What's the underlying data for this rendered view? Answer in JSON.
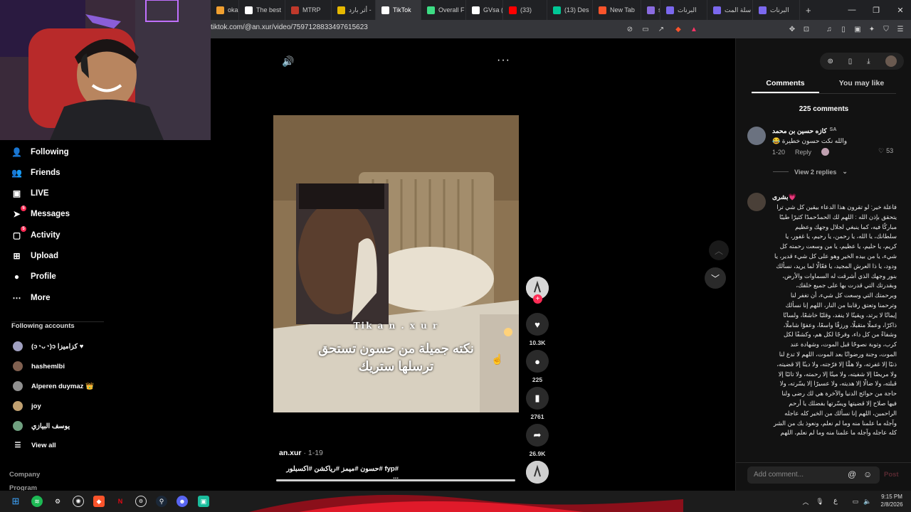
{
  "browser": {
    "tabs": [
      {
        "label": "okanTF",
        "color": "#f0a030"
      },
      {
        "label": "The best",
        "color": "#ffffff"
      },
      {
        "label": "MTRP",
        "color": "#c0392b"
      },
      {
        "label": "أثر بارد -",
        "color": "#e6b800"
      },
      {
        "label": "TikTok",
        "color": "#ffffff",
        "active": true
      },
      {
        "label": "Overall F",
        "color": "#3ddc84"
      },
      {
        "label": "GVsa (@",
        "color": "#ffffff"
      },
      {
        "label": "(33)",
        "color": "#ff0000"
      },
      {
        "label": "(13) Des",
        "color": "#00c896"
      },
      {
        "label": "New Tab",
        "color": "#fb542b"
      },
      {
        "label": "spe",
        "color": "#8a6be0"
      },
      {
        "label": "البرنات",
        "color": "#7b68ee"
      },
      {
        "label": "سلة المت",
        "color": "#7b68ee"
      },
      {
        "label": "البرنات",
        "color": "#7b68ee"
      }
    ],
    "new_tab": "+",
    "url": "tiktok.com/@an.xur/video/7597128833497615623"
  },
  "sidebar": {
    "nav": [
      {
        "label": "Following",
        "icon": "following-icon",
        "glyph": "👤"
      },
      {
        "label": "Friends",
        "icon": "friends-icon",
        "glyph": "👥"
      },
      {
        "label": "LIVE",
        "icon": "live-icon",
        "glyph": "▣"
      },
      {
        "label": "Messages",
        "icon": "messages-icon",
        "glyph": "➤",
        "badge": "5"
      },
      {
        "label": "Activity",
        "icon": "activity-icon",
        "glyph": "▢",
        "badge": "5"
      },
      {
        "label": "Upload",
        "icon": "upload-icon",
        "glyph": "⊞"
      },
      {
        "label": "Profile",
        "icon": "profile-icon",
        "glyph": "●"
      },
      {
        "label": "More",
        "icon": "more-icon",
        "glyph": "⋯"
      }
    ],
    "following_title": "Following accounts",
    "accounts": [
      {
        "name": "(ↄ◔ᴗ◔)ↄ كزاميزا ♥",
        "color": "#a0a0c0"
      },
      {
        "name": "hashemlbi",
        "color": "#806050"
      },
      {
        "name": "Alperen duymaz 👑",
        "color": "#909090"
      },
      {
        "name": "joy",
        "color": "#c0a070"
      },
      {
        "name": "يوسف البيازي",
        "color": "#70a080"
      }
    ],
    "view_all": "View all",
    "footer": [
      "Company",
      "Program"
    ]
  },
  "video": {
    "watermark": "Tik a n . x u r",
    "caption_line1": "نكته جميلة من حسون تستحق",
    "caption_line2": "ترسلها ستريك",
    "author": "an.xur",
    "date": "· 1-19",
    "hashtags": "#fyp #حسون #ميمز #رياكشن #اكسبلور ..."
  },
  "actions": {
    "likes": "10.3K",
    "comments": "225",
    "saves": "2761",
    "shares": "26.9K"
  },
  "panel": {
    "tab_comments": "Comments",
    "tab_like": "You may like",
    "count": "225 comments",
    "comments": [
      {
        "author": "كازه حسين بن محمد",
        "flag": "SA",
        "text": "والله نكت حسون خطيرة 😂",
        "date": "1-20",
        "reply": "Reply",
        "likes": "53",
        "view_replies": "View 2 replies"
      },
      {
        "author": "بشرى💗",
        "text": "فاعلة خير: لو تقرون هذا الدعاء بيقين كل شي ترا يتحقق بإذن الله : اللهم لك الحمدُحمدًا كثيرًا طيبًا مباركًا فيه، كما ينبغي لجلال وجهك وعظيم سلطانك، يا الله، يا رحمن، يا رحيم، يا غفور، يا كريم، يا حليم، يا عظيم، يا من وسعت رحمته كل شيء، يا من بيده الخير وهو على كل شيء قدير، يا ودود، يا ذا العرش المجيد، يا فعّالًا لما يريد، نسألك بنور وجهك الذي أشرقت له السماوات والأرض، وبقدرتك التي قدرت بها على جميع خلقك، وبرحمتك التي وسعت كل شيء، أن تغفر لنا وترحمنا وتعتق رقابنا من النار، اللهم إنا نسألك إيمانًا لا يرتد، ويقينًا لا ينفد، وقلبًا خاشعًا، ولسانًا ذاكرًا، وعملًا متقبلًا، ورزقًا واسعًا، وعفوًا شاملًا، وشفاءً من كل داء، وفرجًا لكل هم، وكشفًا لكل كرب، وتوبة نصوحًا قبل الموت، وشهادة عند الموت، وجنة ورضوانًا بعد الموت، اللهم لا تدع لنا ذنبًا إلا غفرته، ولا همًّا إلا فرّجته، ولا دينًا إلا قضيته، ولا مريضًا إلا شفيته، ولا ميتًا إلا رحمته، ولا تائبًا إلا قبلته، ولا ضالًا إلا هديته، ولا عسيرًا إلا يسّرته، ولا حاجة من حوائج الدنيا والآخرة هي لك رضى ولنا فيها صلاح إلا قضيتها ويسّرتها بفضلك يا أرحم الراحمين، اللهم إنا نسألك من الخير كله عاجله وآجله ما علمنا منه وما لم نعلم، ونعوذ بك من الشر كله عاجله وآجله ما علمنا منه وما لم نعلم، اللهم"
      }
    ],
    "add_comment": "Add comment...",
    "post": "Post"
  },
  "taskbar": {
    "time": "9:15 PM",
    "date": "2/8/2026",
    "lang": "ع"
  },
  "colors": {
    "accent": "#fe2c55",
    "panel_bg": "#121212"
  }
}
